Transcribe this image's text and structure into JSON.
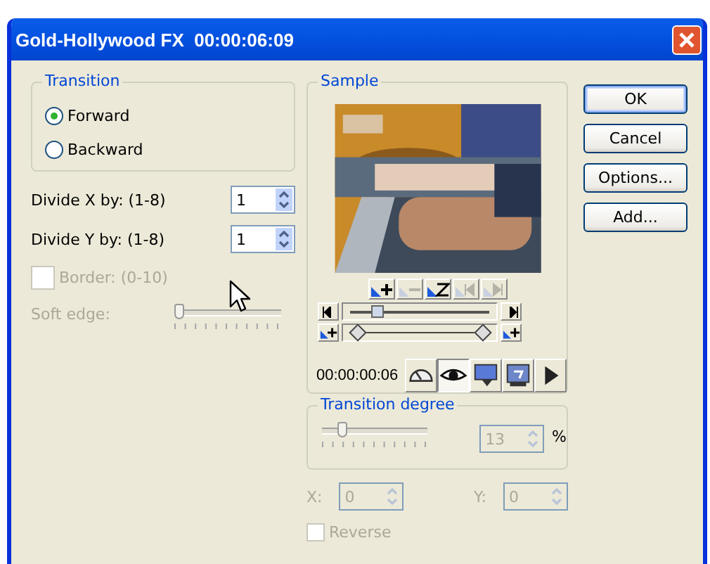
{
  "window": {
    "title": "Gold-Hollywood FX  00:00:06:09"
  },
  "transition": {
    "label": "Transition",
    "options": [
      {
        "label": "Forward",
        "selected": true
      },
      {
        "label": "Backward",
        "selected": false
      }
    ]
  },
  "divide_x": {
    "label": "Divide X by: (1-8)",
    "value": "1"
  },
  "divide_y": {
    "label": "Divide Y by: (1-8)",
    "value": "1"
  },
  "border": {
    "label": "Border: (0-10)",
    "checked": false,
    "disabled": true
  },
  "soft_edge": {
    "label": "Soft edge:",
    "level": 0.0,
    "disabled": true
  },
  "sample": {
    "label": "Sample",
    "edit_tools": [
      {
        "kind": "add",
        "disabled": false
      },
      {
        "kind": "remove",
        "disabled": true
      },
      {
        "kind": "reset",
        "disabled": false
      },
      {
        "kind": "prev",
        "disabled": true
      },
      {
        "kind": "next",
        "disabled": true
      }
    ],
    "seek": {
      "level": 0.15
    },
    "range": {
      "start": {
        "level": 0.0
      },
      "end": {
        "level": 1.0
      }
    },
    "time": "00:00:00:06",
    "view_buttons": [
      {
        "kind": "gauge",
        "selected": false
      },
      {
        "kind": "eye",
        "selected": true
      },
      {
        "kind": "monitor",
        "selected": false
      },
      {
        "kind": "monitor-tool",
        "selected": false
      },
      {
        "kind": "play",
        "selected": false
      }
    ]
  },
  "transition_degree": {
    "label": "Transition degree",
    "level": 0.15,
    "value": "13",
    "unit": "%",
    "disabled": true
  },
  "offset_x": {
    "label": "X:",
    "value": "0",
    "disabled": true
  },
  "offset_y": {
    "label": "Y:",
    "value": "0",
    "disabled": true
  },
  "reverse": {
    "label": "Reverse",
    "checked": false,
    "disabled": true
  },
  "buttons": [
    {
      "label": "OK",
      "default": true
    },
    {
      "label": "Cancel",
      "default": false
    },
    {
      "label": "Options...",
      "default": false
    },
    {
      "label": "Add...",
      "default": false
    }
  ]
}
